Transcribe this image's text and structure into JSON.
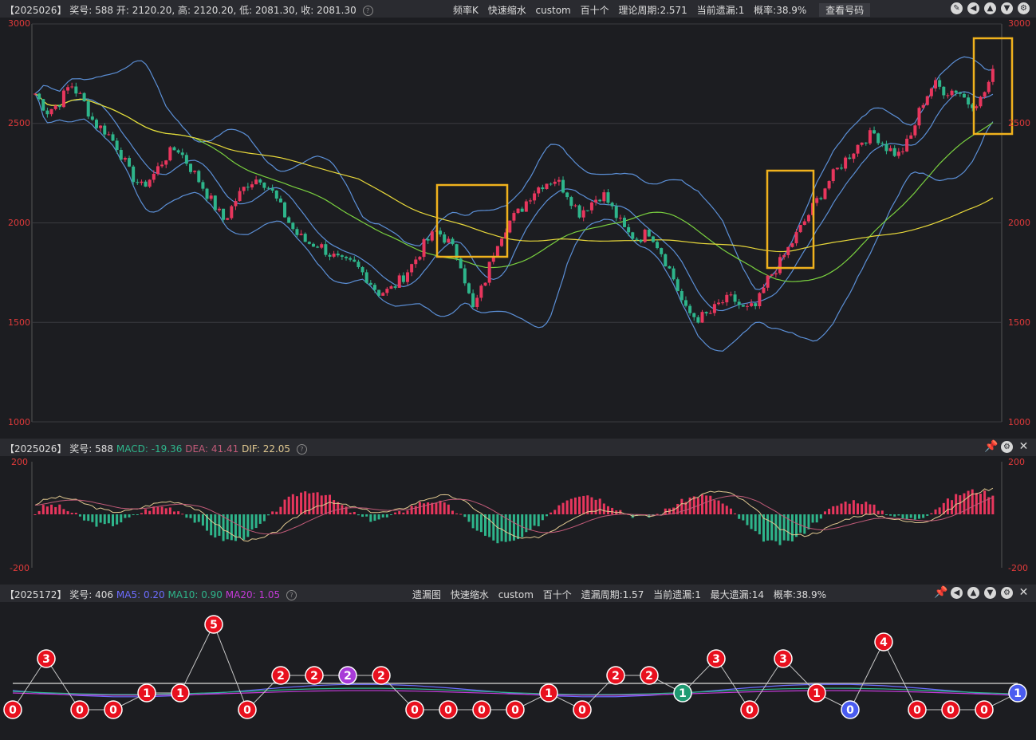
{
  "kline": {
    "header": {
      "draw": "【2025026】",
      "award_label": "奖号:",
      "award": "588",
      "open": "开: 2120.20,",
      "high": "高: 2120.20,",
      "low": "低: 2081.30,",
      "close": "收: 2081.30"
    },
    "center": [
      "频率K",
      "快速缩水",
      "custom",
      "百十个",
      "理论周期:2.571",
      "当前遗漏:1",
      "概率:38.9%"
    ],
    "view_button": "查看号码",
    "y_ticks": [
      "3000",
      "2500",
      "2000",
      "1500",
      "1000"
    ]
  },
  "macd": {
    "draw": "【2025026】",
    "award_label": "奖号:",
    "award": "588",
    "macd": "MACD: -19.36",
    "dea": "DEA: 41.41",
    "dif": "DIF: 22.05",
    "y_ticks": [
      "200",
      "-200"
    ]
  },
  "omission": {
    "draw": "【2025172】",
    "award_label": "奖号:",
    "award": "406",
    "ma5": "MA5: 0.20",
    "ma10": "MA10: 0.90",
    "ma20": "MA20: 1.05",
    "center": [
      "遗漏图",
      "快速缩水",
      "custom",
      "百十个",
      "遗漏周期:1.57",
      "当前遗漏:1",
      "最大遗漏:14",
      "概率:38.9%"
    ],
    "values": [
      0,
      3,
      0,
      0,
      1,
      1,
      5,
      0,
      2,
      2,
      2,
      2,
      0,
      0,
      0,
      0,
      1,
      0,
      2,
      2,
      1,
      3,
      0,
      3,
      1,
      0,
      4,
      0,
      0,
      0,
      1
    ],
    "special": {
      "4": "red",
      "8": "red",
      "10": "purple",
      "20": "teal",
      "25": "blue",
      "30": "blue"
    }
  },
  "chart_data": [
    {
      "type": "candlestick",
      "y_ticks": [
        3000,
        2500,
        2000,
        1500,
        1000
      ],
      "ylim": [
        1000,
        3000
      ],
      "close_path": [
        2650,
        2560,
        2600,
        2700,
        2620,
        2500,
        2460,
        2380,
        2250,
        2180,
        2240,
        2330,
        2380,
        2290,
        2200,
        2100,
        2010,
        2120,
        2200,
        2230,
        2160,
        2050,
        1950,
        1900,
        1890,
        1840,
        1800,
        1790,
        1730,
        1650,
        1660,
        1720,
        1800,
        1900,
        1960,
        1900,
        1800,
        1560,
        1700,
        1900,
        2000,
        2060,
        2150,
        2200,
        2220,
        2150,
        2050,
        2100,
        2150,
        2050,
        1950,
        1920,
        1960,
        1850,
        1720,
        1560,
        1520,
        1540,
        1600,
        1620,
        1560,
        1580,
        1720,
        1800,
        1900,
        2000,
        2100,
        2200,
        2280,
        2350,
        2420,
        2450,
        2380,
        2340,
        2420,
        2600,
        2700,
        2660,
        2670,
        2600,
        2620,
        2750
      ]
    },
    {
      "type": "macd",
      "ylim": [
        -200,
        200
      ],
      "y_ticks": [
        200,
        -200
      ]
    },
    {
      "type": "omission",
      "values": [
        0,
        3,
        0,
        0,
        1,
        1,
        5,
        0,
        2,
        2,
        2,
        2,
        0,
        0,
        0,
        0,
        1,
        0,
        2,
        2,
        1,
        3,
        0,
        3,
        1,
        0,
        4,
        0,
        0,
        0,
        1
      ]
    }
  ]
}
